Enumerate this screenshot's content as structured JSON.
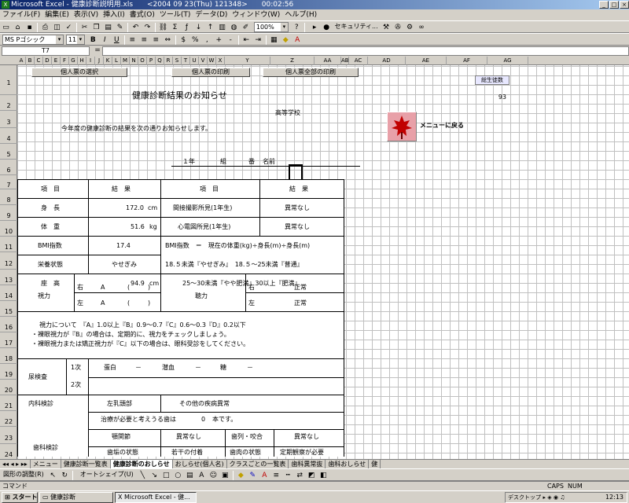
{
  "window": {
    "title": "Microsoft Excel - 健康診断説明用.xls　　<2004 09 23(Thu) 121348>　　00:02:56"
  },
  "menu": [
    "ファイル(F)",
    "編集(E)",
    "表示(V)",
    "挿入(I)",
    "書式(O)",
    "ツール(T)",
    "データ(D)",
    "ウィンドウ(W)",
    "ヘルプ(H)"
  ],
  "toolbar": {
    "zoom": "100%",
    "security": "セキュリティ..."
  },
  "format": {
    "font": "MS Pゴシック",
    "size": "11"
  },
  "namebox": "T7",
  "columns": [
    "A",
    "B",
    "C",
    "D",
    "E",
    "F",
    "G",
    "H",
    "I",
    "J",
    "K",
    "L",
    "M",
    "N",
    "O",
    "P",
    "Q",
    "R",
    "S",
    "T",
    "U",
    "V",
    "W",
    "X",
    "Y",
    "Z",
    "AA",
    "AB",
    "AC",
    "AD",
    "AE",
    "AF",
    "AG"
  ],
  "rows": [
    "1",
    "2",
    "3",
    "4",
    "5",
    "6",
    "7",
    "8",
    "9",
    "10",
    "11",
    "12",
    "13",
    "14",
    "15",
    "16",
    "17",
    "18",
    "19",
    "20",
    "21",
    "22",
    "23",
    "24"
  ],
  "buttons": {
    "btn1": "個人票の選択",
    "btn2": "個人票の印刷",
    "btn3": "個人票全部の印刷",
    "menu": "メニューに戻る"
  },
  "side": {
    "label": "総生徒数",
    "value": "93"
  },
  "doc": {
    "title": "健康診断結果のお知らせ",
    "school": "高等学校",
    "intro": "今年度の健康診断の結果を次の通りお知らせします。",
    "grade": "１年",
    "class_label": "組",
    "num_label": "番",
    "name_label": "名前"
  },
  "form": {
    "h_item": "項　目",
    "h_result": "結　果",
    "h_item2": "項　目",
    "h_result2": "結　果",
    "height_l": "身　長",
    "height_v": "172.0",
    "height_u": "cm",
    "weight_l": "体　重",
    "weight_v": "51.6",
    "weight_u": "kg",
    "xray_l": "間接撮影所見(1年生)",
    "xray_v": "異常なし",
    "ecg_l": "心電図所見(1年生)",
    "ecg_v": "異常なし",
    "bmi_l": "BMI指数",
    "bmi_v": "17.4",
    "bmi_formula": "BMI指数　＝　現在の体重(kg)÷身長(m)÷身長(m)",
    "nut_l": "栄養状態",
    "nut_v": "やせぎみ",
    "bmi_r1": "18.５未満『やせぎみ』　18.５～25未満『普通』",
    "bmi_r2": "25～30未満『やや肥満』30以上『肥満』",
    "sit_l": "座　高",
    "sit_v": "94.9",
    "sit_u": "cm",
    "vision_l": "視力",
    "right": "右",
    "left": "左",
    "va_r": "A",
    "va_l": "A",
    "paren_o": "(",
    "paren_c": ")",
    "hear_l": "聴力",
    "hear_r": "右",
    "hear_l2": "左",
    "hear_rv": "正常",
    "hear_lv": "正常",
    "note1": "視力について　『A』1.0以上『B』0.9～0.7『C』0.6～0.3『D』0.2以下",
    "note2": "・裸眼視力が『B』の場合は、定期的に、視力をチェックしましょう。",
    "note3": "・裸眼視力または矯正視力が『C』以下の場合は、眼科受診をしてください。",
    "urine_l": "尿検査",
    "first": "1次",
    "second": "2次",
    "protein": "蛋白",
    "dash": "－",
    "blood": "潜血",
    "sugar": "糖",
    "internal_l": "内科検診",
    "internal_v": "左乳頭部",
    "other_v": "その他の疾病異常",
    "dental_l": "歯科検診",
    "treat": "治療が必要と考えうる歯は",
    "treat_n": "0",
    "treat_u": "本です。",
    "tmj": "顎関節",
    "tmj_v": "異常なし",
    "bite": "歯列・咬合",
    "bite_v": "異常なし",
    "plaque": "歯垢の状態",
    "plaque_v": "若干の付着",
    "gum": "歯肉の状態",
    "gum_v": "定期観察が必要"
  },
  "tabs": [
    "メニュー",
    "健康診断一覧表",
    "健康診断のおしらせ",
    "おしらせ(個人名)",
    "クラスごとの一覧表",
    "歯科異常抜",
    "歯科おしらせ",
    "健"
  ],
  "drawbar": {
    "draw": "図形の調整(R)",
    "autoshape": "オートシェイプ(U)"
  },
  "status": {
    "left": "コマンド",
    "caps": "CAPS",
    "num": "NUM"
  },
  "taskbar": {
    "start": "スタート",
    "task1": "健康診断",
    "task2": "Microsoft Excel - 健...",
    "clock": "12:13",
    "tray": "デスクトップ"
  }
}
